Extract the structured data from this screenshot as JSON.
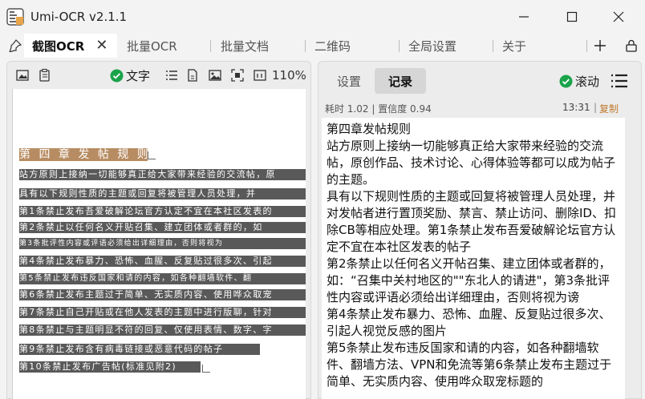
{
  "window": {
    "title": "Umi-OCR v2.1.1"
  },
  "tabs": [
    {
      "label": "截图OCR",
      "active": true
    },
    {
      "label": "批量OCR"
    },
    {
      "label": "批量文档"
    },
    {
      "label": "二维码"
    },
    {
      "label": "全局设置"
    },
    {
      "label": "关于"
    }
  ],
  "left_toolbar": {
    "text_label": "文字",
    "zoom": "110%"
  },
  "ocr_lines": [
    {
      "text": "第 四 章 发 帖 规 则",
      "heading": true
    },
    {
      "text": "站方原则上接纳一切能够真正给大家带来经验的交流帖，原"
    },
    {
      "text": "具有以下规则性质的主题或回复将被管理人员处理，并"
    },
    {
      "text": "第1条禁止发布吾爱破解论坛官方认定不宜在本社区发表的"
    },
    {
      "text": "第2条禁止以任何名义开贴召集、建立团体或者群的，如"
    },
    {
      "text": "第3条批评性内容或评语必须给出详细理由，否则将视为"
    },
    {
      "text": "第4条禁止发布暴力、恐怖、血腥、反复贴过很多次、引起"
    },
    {
      "text": "第5条禁止发布违反国家和请的内容，如各种翻墙软件、翻"
    },
    {
      "text": "第6条禁止发布主题过于简单、无实质内容、使用哗众取宠"
    },
    {
      "text": "第7条禁止自己开贴或在他人发表的主题中进行版聊，针对"
    },
    {
      "text": "第8条禁止与主题明显不符的回复、仅使用表情、数字、字"
    },
    {
      "text": "第9条禁止发布含有病毒链接或恶意代码的帖子"
    },
    {
      "text": "第10条禁止发布广告帖(标准见附2)"
    }
  ],
  "right_panel": {
    "tabs": [
      {
        "label": "设置"
      },
      {
        "label": "记录",
        "active": true
      }
    ],
    "scroll_label": "滚动",
    "meta": "耗时 1.02 | 置信度 0.94",
    "time": "13:31",
    "sep": "|",
    "copy_label": "复制",
    "result_text": "第四章发帖规则\n站方原则上接纳一切能够真正给大家带来经验的交流帖，原创作品、技术讨论、心得体验等都可以成为帖子的主题。\n具有以下规则性质的主题或回复将被管理人员处理，并对发帖者进行置顶奖励、禁言、禁止访问、删除ID、扣除CB等相应处理。第1条禁止发布吾爱破解论坛官方认定不宜在本社区发表的帖子\n第2条禁止以任何名义开帖召集、建立团体或者群的，如：“召集中关村地区的\"\"东北人的请进\"，第3条批评性内容或评语必须给出详细理由，否则将视为谤\n第4条禁止发布暴力、恐怖、血腥、反复贴过很多次、引起人视觉反感的图片\n第5条禁止发布违反国家和请的内容，如各种翻墙软件、翻墙方法、VPN和免流等第6条禁止发布主题过于简单、无实质内容、使用哗众取宠标题的"
  },
  "colors": {
    "accent_green": "#1aa34a",
    "copy": "#c07a30",
    "highlight": "#4b4b4b"
  }
}
